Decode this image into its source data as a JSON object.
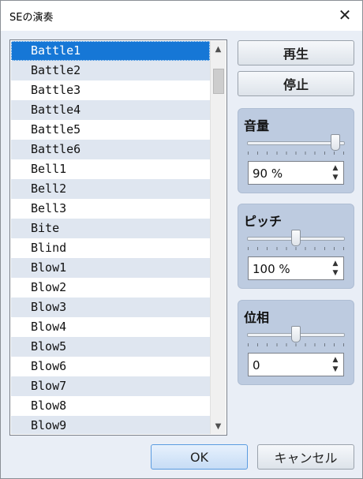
{
  "window": {
    "title": "SEの演奏",
    "close_glyph": "✕"
  },
  "list": {
    "items": [
      {
        "label": "Battle1",
        "selected": true
      },
      {
        "label": "Battle2"
      },
      {
        "label": "Battle3"
      },
      {
        "label": "Battle4"
      },
      {
        "label": "Battle5"
      },
      {
        "label": "Battle6"
      },
      {
        "label": "Bell1"
      },
      {
        "label": "Bell2"
      },
      {
        "label": "Bell3"
      },
      {
        "label": "Bite"
      },
      {
        "label": "Blind"
      },
      {
        "label": "Blow1"
      },
      {
        "label": "Blow2"
      },
      {
        "label": "Blow3"
      },
      {
        "label": "Blow4"
      },
      {
        "label": "Blow5"
      },
      {
        "label": "Blow6"
      },
      {
        "label": "Blow7"
      },
      {
        "label": "Blow8"
      },
      {
        "label": "Blow9"
      }
    ],
    "scroll_up_glyph": "▲",
    "scroll_down_glyph": "▼"
  },
  "buttons": {
    "play_label": "再生",
    "stop_label": "停止",
    "ok_label": "OK",
    "cancel_label": "キャンセル"
  },
  "volume": {
    "label": "音量",
    "value_text": "90 %",
    "slider_fraction": 0.9
  },
  "pitch": {
    "label": "ピッチ",
    "value_text": "100 %",
    "slider_fraction": 0.5
  },
  "pan": {
    "label": "位相",
    "value_text": "0",
    "slider_fraction": 0.5
  },
  "spin_up_glyph": "▲",
  "spin_down_glyph": "▼",
  "colors": {
    "selection": "#1677d6",
    "panel": "#bdcbe0",
    "alt_row": "#dfe6f0"
  }
}
